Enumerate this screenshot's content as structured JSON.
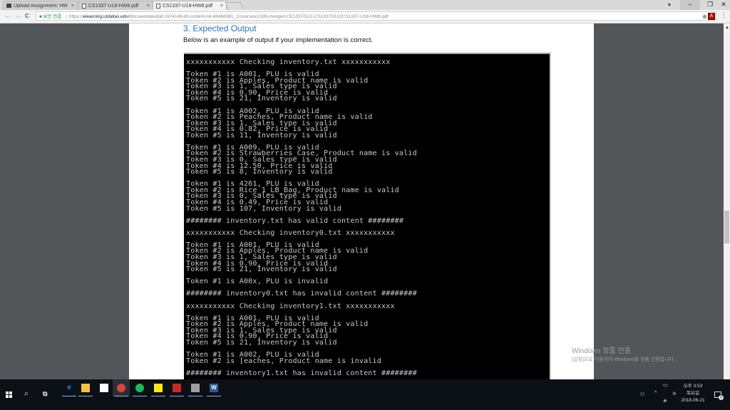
{
  "browser": {
    "tabs": [
      {
        "label": "Upload Assignment: HW",
        "icon": "blackboard-icon",
        "active": false
      },
      {
        "label": "CS1337-U18-HW8.pdf",
        "icon": "document-icon",
        "active": false
      },
      {
        "label": "CS1337-U18-HW8.pdf",
        "icon": "document-icon",
        "active": true
      }
    ],
    "tab_close": "×",
    "window_controls": {
      "profile": "●",
      "minimize": "–",
      "restore": "❐",
      "close": "✕"
    },
    "nav": {
      "back": "←",
      "forward": "→",
      "reload": "C"
    },
    "address": {
      "secure_label": "보안 연결",
      "scheme": "https://",
      "host": "elearning.utdallas.edu",
      "path": "/bbcswebdav/pid-1974149-dt-content-rid-48466381_1/courses/2185-merged-CE1337OU2-CS1337OU2/CS1337-U18-HW8.pdf"
    },
    "omnibox_icons": {
      "zoom": "⊕",
      "star": "☆"
    },
    "extension_label": "A",
    "menu": "⋮"
  },
  "document": {
    "heading": "3.  Expected Output",
    "intro": "Below is an example of output if your implementation is correct.",
    "console_lines": [
      "xxxxxxxxxxx Checking inventory.txt xxxxxxxxxxx",
      "",
      "Token #1 is A001, PLU is valid",
      "Token #2 is Apples, Product name is valid",
      "Token #3 is 1, Sales type is valid",
      "Token #4 is 0.90, Price is valid",
      "Token #5 is 21, Inventory is valid",
      "",
      "Token #1 is A002, PLU is valid",
      "Token #2 is Peaches, Product name is valid",
      "Token #3 is 1, Sales type is valid",
      "Token #4 is 0.82, Price is valid",
      "Token #5 is 11, Inventory is valid",
      "",
      "Token #1 is A009, PLU is valid",
      "Token #2 is Strawberries_Case, Product name is valid",
      "Token #3 is 0, Sales type is valid",
      "Token #4 is 12.50, Price is valid",
      "Token #5 is 8, Inventory is valid",
      "",
      "Token #1 is 4261, PLU is valid",
      "Token #2 is Rice_1_LB_Bag, Product name is valid",
      "Token #3 is 0, Sales type is valid",
      "Token #4 is 0.49, Price is valid",
      "Token #5 is 107, Inventory is valid",
      "",
      "######## inventory.txt has valid content ########",
      "",
      "xxxxxxxxxxx Checking inventory0.txt xxxxxxxxxxx",
      "",
      "Token #1 is A001, PLU is valid",
      "Token #2 is Apples, Product name is valid",
      "Token #3 is 1, Sales type is valid",
      "Token #4 is 0.90, Price is valid",
      "Token #5 is 21, Inventory is valid",
      "",
      "Token #1 is A00x, PLU is invalid",
      "",
      "######## inventory0.txt has invalid content ########",
      "",
      "xxxxxxxxxxx Checking inventory1.txt xxxxxxxxxxx",
      "",
      "Token #1 is A001, PLU is valid",
      "Token #2 is Apples, Product name is valid",
      "Token #3 is 1, Sales type is valid",
      "Token #4 is 0.90, Price is valid",
      "Token #5 is 21, Inventory is valid",
      "",
      "Token #1 is A002, PLU is valid",
      "Token #2 is [eaches, Product name is invalid",
      "",
      "######## inventory1.txt has invalid content ########"
    ]
  },
  "scrollbar": {
    "up_arrow": "▲",
    "position_fraction": 0.55
  },
  "watermark": {
    "title": "Windows 정품 인증",
    "subtitle": "[설정]으로 이동하여 Windows를 정품 인증합니다."
  },
  "taskbar": {
    "apps": [
      {
        "name": "edge",
        "label": "e",
        "color": "#1e88e5"
      },
      {
        "name": "file-explorer",
        "label": "",
        "color": "#f3c33b"
      },
      {
        "name": "store",
        "label": "",
        "color": "#ffffff"
      },
      {
        "name": "chrome",
        "label": "",
        "color": "#db4437"
      },
      {
        "name": "spotify",
        "label": "",
        "color": "#1db954"
      },
      {
        "name": "kakaotalk",
        "label": "",
        "color": "#ffe812"
      },
      {
        "name": "app-tiles",
        "label": "",
        "color": "#c62828"
      },
      {
        "name": "paint",
        "label": "",
        "color": "#9e9e9e"
      },
      {
        "name": "word",
        "label": "W",
        "color": "#2b579a"
      }
    ],
    "tray": {
      "people": "⚇",
      "chevron": "^",
      "network": "▭",
      "volume": "🔈",
      "ime": "⊗"
    },
    "clock": {
      "time": "오후 3:53",
      "day": "목요일",
      "date": "2018-06-21"
    },
    "notification_count": "1"
  }
}
